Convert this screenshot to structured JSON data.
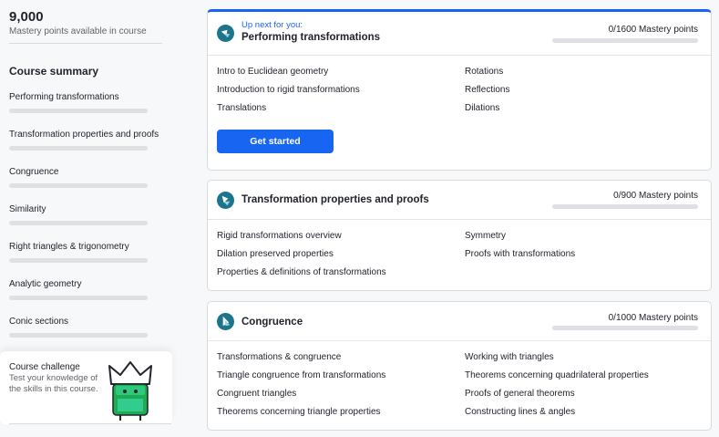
{
  "sidebar": {
    "points_value": "9,000",
    "points_label": "Mastery points available in course",
    "summary_title": "Course summary",
    "items": [
      {
        "label": "Performing transformations"
      },
      {
        "label": "Transformation properties and proofs"
      },
      {
        "label": "Congruence"
      },
      {
        "label": "Similarity"
      },
      {
        "label": "Right triangles & trigonometry"
      },
      {
        "label": "Analytic geometry"
      },
      {
        "label": "Conic sections"
      }
    ],
    "challenge": {
      "title": "Course challenge",
      "description": "Test your knowledge of the skills in this course."
    }
  },
  "cards": [
    {
      "upnext": "Up next for you:",
      "title": "Performing transformations",
      "mastery": "0/1600 Mastery points",
      "progress": 0,
      "lessons_left": [
        "Intro to Euclidean geometry",
        "Introduction to rigid transformations",
        "Translations"
      ],
      "lessons_right": [
        "Rotations",
        "Reflections",
        "Dilations"
      ],
      "button": "Get started"
    },
    {
      "title": "Transformation properties and proofs",
      "mastery": "0/900 Mastery points",
      "progress": 0,
      "lessons_left": [
        "Rigid transformations overview",
        "Dilation preserved properties",
        "Properties & definitions of transformations"
      ],
      "lessons_right": [
        "Symmetry",
        "Proofs with transformations"
      ]
    },
    {
      "title": "Congruence",
      "mastery": "0/1000 Mastery points",
      "progress": 0,
      "lessons_left": [
        "Transformations & congruence",
        "Triangle congruence from transformations",
        "Congruent triangles",
        "Theorems concerning triangle properties"
      ],
      "lessons_right": [
        "Working with triangles",
        "Theorems concerning quadrilateral properties",
        "Proofs of general theorems",
        "Constructing lines & angles"
      ]
    }
  ],
  "colors": {
    "accent": "#1865f2",
    "icon_teal": "#1c758a",
    "progress_track": "#dfe0e3"
  },
  "icons": {
    "card_icon": "unit-icon",
    "mascot": "crown-character"
  }
}
